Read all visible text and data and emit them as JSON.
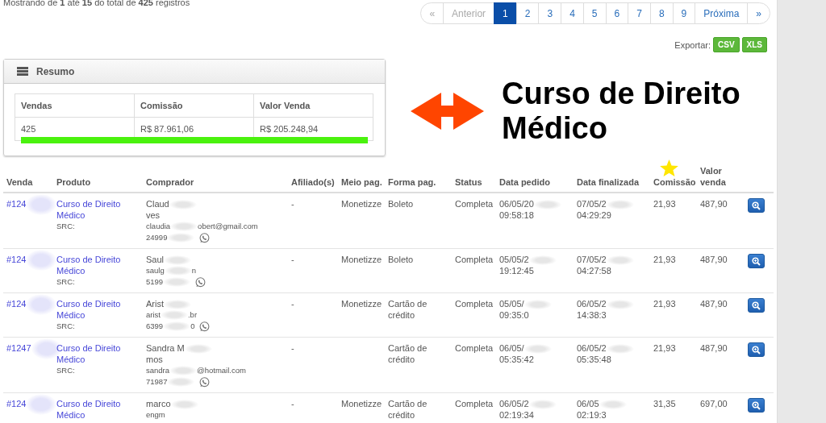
{
  "info": "Mostrando de **1** até **15** do total de **425** registros",
  "pagination": [
    {
      "label": "«",
      "selected": false,
      "disabled": true
    },
    {
      "label": "Anterior",
      "selected": false,
      "disabled": true
    },
    {
      "label": "1",
      "selected": true,
      "disabled": false
    },
    {
      "label": "2",
      "selected": false,
      "disabled": false
    },
    {
      "label": "3",
      "selected": false,
      "disabled": false
    },
    {
      "label": "4",
      "selected": false,
      "disabled": false
    },
    {
      "label": "5",
      "selected": false,
      "disabled": false
    },
    {
      "label": "6",
      "selected": false,
      "disabled": false
    },
    {
      "label": "7",
      "selected": false,
      "disabled": false
    },
    {
      "label": "8",
      "selected": false,
      "disabled": false
    },
    {
      "label": "9",
      "selected": false,
      "disabled": false
    },
    {
      "label": "Próxima",
      "selected": false,
      "disabled": false
    },
    {
      "label": "»",
      "selected": false,
      "disabled": false
    }
  ],
  "export": {
    "label": "Exportar:",
    "buttons": [
      "CSV",
      "XLS"
    ]
  },
  "summary": {
    "title": "Resumo",
    "columns": [
      "Vendas",
      "Comissão",
      "Valor Venda"
    ],
    "row": [
      "425",
      "R$ 87.961,06",
      "R$ 205.248,94"
    ]
  },
  "callout": {
    "title": "Curso de Direito Médico"
  },
  "table": {
    "columns": [
      "Venda",
      "Produto",
      "Comprador",
      "Afiliado(s)",
      "Meio pag.",
      "Forma pag.",
      "Status",
      "Data pedido",
      "Data finalizada",
      "Comissão",
      "Valor venda"
    ],
    "rows": [
      {
        "venda": "#124",
        "produto": "Curso de Direito Médico",
        "src": "SRC:",
        "name": [
          [
            "Claud"
          ],
          [
            "ves"
          ]
        ],
        "email": [
          "claudia",
          "obert@gmail.com"
        ],
        "phone": [
          "24999"
        ],
        "afiliado": "-",
        "meio": "Monetizze",
        "forma": "Boleto",
        "status": "Completa",
        "pedido": [
          "06/05/20",
          "09:58:18"
        ],
        "finalizada": [
          "07/05/2",
          "04:29:29"
        ],
        "comissao": "21,93",
        "valor": "487,90"
      },
      {
        "venda": "#124",
        "produto": "Curso de Direito Médico",
        "src": "SRC:",
        "name": [
          [
            "Saul"
          ]
        ],
        "email": [
          "saulg",
          "n"
        ],
        "phone": [
          "5199"
        ],
        "afiliado": "-",
        "meio": "Monetizze",
        "forma": "Boleto",
        "status": "Completa",
        "pedido": [
          "05/05/2",
          "19:12:45"
        ],
        "finalizada": [
          "07/05/2",
          "04:27:58"
        ],
        "comissao": "21,93",
        "valor": "487,90"
      },
      {
        "venda": "#124",
        "produto": "Curso de Direito Médico",
        "src": "SRC:",
        "name": [
          [
            "Arist"
          ]
        ],
        "email": [
          "arist",
          ".br"
        ],
        "phone": [
          "6399",
          "0"
        ],
        "afiliado": "-",
        "meio": "Monetizze",
        "forma": "Cartão de crédito",
        "status": "Completa",
        "pedido": [
          "05/05/",
          "09:35:0"
        ],
        "finalizada": [
          "06/05/2",
          "14:38:3"
        ],
        "comissao": "21,93",
        "valor": "487,90"
      },
      {
        "venda": "#1247",
        "produto": "Curso de Direito Médico",
        "src": "SRC:",
        "name": [
          [
            "Sandra M"
          ],
          [
            "mos"
          ]
        ],
        "email": [
          "sandra",
          "@hotmail.com"
        ],
        "phone": [
          "71987"
        ],
        "afiliado": "-",
        "forma": "Cartão de crédito",
        "status": "Completa",
        "pedido": [
          "06/05/",
          "05:35:42"
        ],
        "finalizada": [
          "06/05/2",
          "05:35:48"
        ],
        "comissao": "21,93",
        "valor": "487,90"
      },
      {
        "venda": "#124",
        "produto": "Curso de Direito Médico",
        "name": [
          [
            "marco"
          ]
        ],
        "email": [
          "engm"
        ],
        "afiliado": "-",
        "meio": "Monetizze",
        "forma": "Cartão de crédito",
        "status": "Completa",
        "pedido": [
          "06/05/2",
          "02:19:34"
        ],
        "finalizada": [
          "06/05",
          "02:19:3"
        ],
        "comissao": "31,35",
        "valor": "697,00"
      }
    ]
  }
}
